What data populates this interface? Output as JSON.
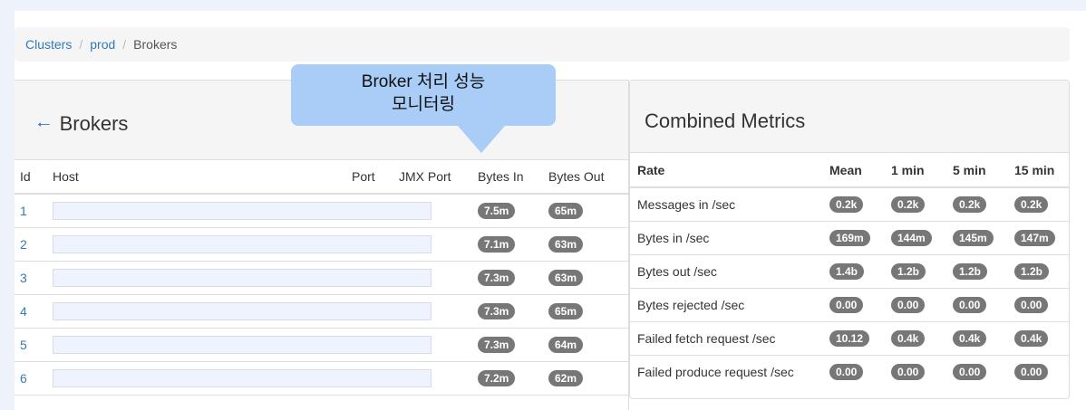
{
  "breadcrumb": {
    "clusters": "Clusters",
    "prod": "prod",
    "current": "Brokers"
  },
  "callout": {
    "line1": "Broker 처리 성능",
    "line2": "모니터링"
  },
  "brokers": {
    "title": "Brokers",
    "headers": {
      "id": "Id",
      "host": "Host",
      "port": "Port",
      "jmx_port": "JMX Port",
      "bytes_in": "Bytes In",
      "bytes_out": "Bytes Out"
    },
    "rows": [
      {
        "id": "1",
        "bytes_in": "7.5m",
        "bytes_out": "65m"
      },
      {
        "id": "2",
        "bytes_in": "7.1m",
        "bytes_out": "63m"
      },
      {
        "id": "3",
        "bytes_in": "7.3m",
        "bytes_out": "63m"
      },
      {
        "id": "4",
        "bytes_in": "7.3m",
        "bytes_out": "65m"
      },
      {
        "id": "5",
        "bytes_in": "7.3m",
        "bytes_out": "64m"
      },
      {
        "id": "6",
        "bytes_in": "7.2m",
        "bytes_out": "62m"
      }
    ]
  },
  "metrics": {
    "title": "Combined Metrics",
    "headers": {
      "rate": "Rate",
      "mean": "Mean",
      "m1": "1 min",
      "m5": "5 min",
      "m15": "15 min"
    },
    "rows": [
      {
        "rate": "Messages in /sec",
        "mean": "0.2k",
        "m1": "0.2k",
        "m5": "0.2k",
        "m15": "0.2k"
      },
      {
        "rate": "Bytes in /sec",
        "mean": "169m",
        "m1": "144m",
        "m5": "145m",
        "m15": "147m"
      },
      {
        "rate": "Bytes out /sec",
        "mean": "1.4b",
        "m1": "1.2b",
        "m5": "1.2b",
        "m15": "1.2b"
      },
      {
        "rate": "Bytes rejected /sec",
        "mean": "0.00",
        "m1": "0.00",
        "m5": "0.00",
        "m15": "0.00"
      },
      {
        "rate": "Failed fetch request /sec",
        "mean": "10.12",
        "m1": "0.4k",
        "m5": "0.4k",
        "m15": "0.4k"
      },
      {
        "rate": "Failed produce request /sec",
        "mean": "0.00",
        "m1": "0.00",
        "m5": "0.00",
        "m15": "0.00"
      }
    ]
  }
}
